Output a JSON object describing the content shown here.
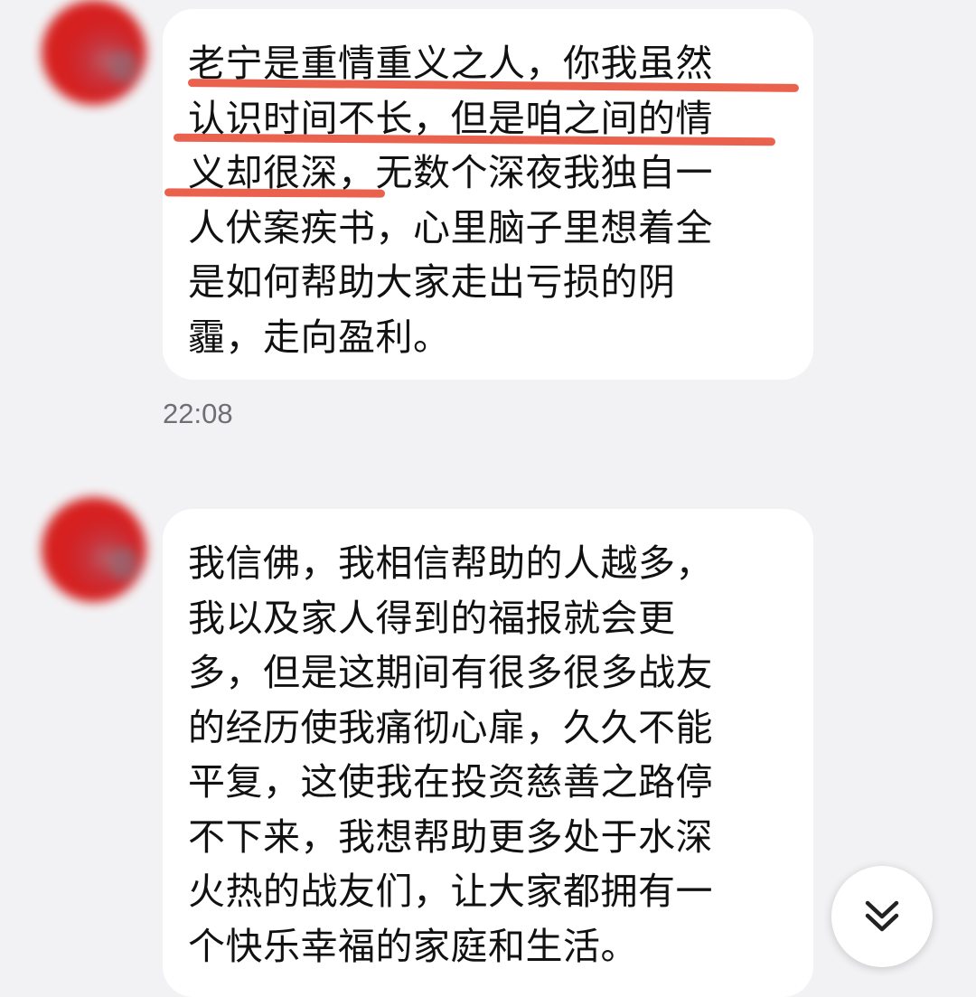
{
  "messages": [
    {
      "text": "老宁是重情重义之人，你我虽然\n认识时间不长，但是咱之间的情\n义却很深，无数个深夜我独自一\n人伏案疾书，心里脑子里想着全\n是如何帮助大家走出亏损的阴\n霾，走向盈利。"
    },
    {
      "text": "我信佛，我相信帮助的人越多，\n我以及家人得到的福报就会更\n多，但是这期间有很多很多战友\n的经历使我痛彻心扉，久久不能\n平复，这使我在投资慈善之路停\n不下来，我想帮助更多处于水深\n火热的战友们，让大家都拥有一\n个快乐幸福的家庭和生活。"
    }
  ],
  "timestamp": "22:08",
  "scroll_button": {
    "icon": "double-chevron-down-icon"
  },
  "colors": {
    "background": "#f2f2f4",
    "bubble": "#ffffff",
    "highlight": "#e8553e",
    "avatar": "#d42a24"
  }
}
